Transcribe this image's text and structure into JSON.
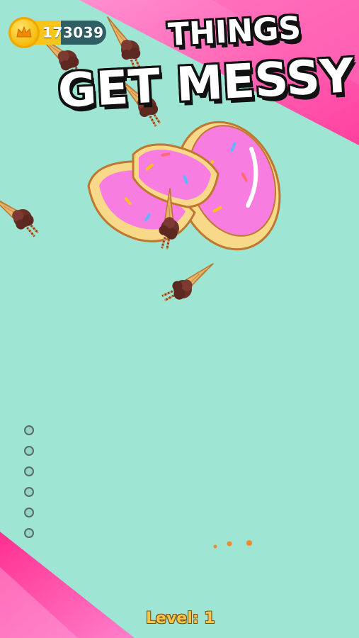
{
  "hud": {
    "coins": "173039",
    "coin_icon": "crown-coin-icon"
  },
  "title": {
    "line1": "THINGS",
    "line2": "GET MESSY"
  },
  "level": {
    "label": "Level: 1"
  },
  "shots": {
    "remaining": 6
  },
  "colors": {
    "background": "#9ee5d3",
    "accent_pink": "#ff4fa8",
    "donut_icing": "#f77ee0",
    "donut_dough": "#f8d98a",
    "chocolate": "#6b3028",
    "cone": "#e8b36a",
    "level_text": "#f3c54a"
  }
}
